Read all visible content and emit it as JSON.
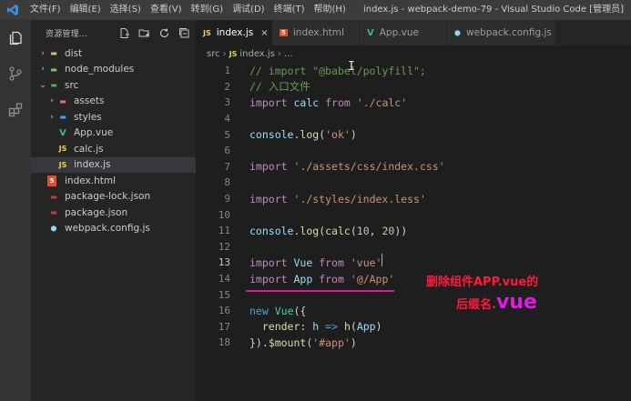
{
  "window": {
    "menu": [
      "文件(F)",
      "编辑(E)",
      "选择(S)",
      "查看(V)",
      "转到(G)",
      "调试(D)",
      "终端(T)",
      "帮助(H)"
    ],
    "title": "index.js - webpack-demo-79 - Visual Studio Code [管理员]"
  },
  "activity_bar": {
    "icons": [
      "files-icon",
      "source-control-icon",
      "extensions-icon"
    ]
  },
  "sidebar": {
    "title": "资源管理...",
    "actions": [
      "new-file-icon",
      "new-folder-icon",
      "refresh-icon",
      "collapse-all-icon"
    ],
    "tree": [
      {
        "label": "dist",
        "chevron": "›",
        "icon": "folder-icon"
      },
      {
        "label": "node_modules",
        "chevron": "›",
        "icon": "folder-node-icon"
      },
      {
        "label": "src",
        "chevron": "⌄",
        "icon": "folder-src-icon"
      },
      {
        "label": "assets",
        "chevron": "›",
        "icon": "folder-assets-icon"
      },
      {
        "label": "styles",
        "chevron": "›",
        "icon": "folder-styles-icon"
      },
      {
        "label": "App.vue",
        "chevron": "",
        "icon": "vue-file-icon",
        "badge": "V"
      },
      {
        "label": "calc.js",
        "chevron": "",
        "icon": "js-file-icon",
        "badge": "JS"
      },
      {
        "label": "index.js",
        "chevron": "",
        "icon": "js-file-icon",
        "badge": "JS"
      },
      {
        "label": "index.html",
        "chevron": "",
        "icon": "html-file-icon",
        "badge": "5"
      },
      {
        "label": "package-lock.json",
        "chevron": "",
        "icon": "npm-file-icon",
        "badge": ""
      },
      {
        "label": "package.json",
        "chevron": "",
        "icon": "npm-file-icon",
        "badge": ""
      },
      {
        "label": "webpack.config.js",
        "chevron": "",
        "icon": "webpack-file-icon",
        "badge": ""
      }
    ]
  },
  "tabs": [
    {
      "label": "index.js",
      "badge": "JS",
      "close": "×"
    },
    {
      "label": "index.html",
      "badge": "5",
      "close": ""
    },
    {
      "label": "App.vue",
      "badge": "V",
      "close": ""
    },
    {
      "label": "webpack.config.js",
      "badge": "",
      "close": ""
    }
  ],
  "breadcrumb": {
    "folder": "src",
    "sep": "›",
    "badge": "JS",
    "file": "index.js",
    "more": "..."
  },
  "editor": {
    "lines": [
      {
        "n": "1",
        "tokens": [
          [
            "cm",
            "// import \"@babel/polyfill\";"
          ]
        ]
      },
      {
        "n": "2",
        "tokens": [
          [
            "cm",
            "// 入口文件"
          ]
        ]
      },
      {
        "n": "3",
        "tokens": [
          [
            "kw",
            "import"
          ],
          [
            "pn",
            " "
          ],
          [
            "var",
            "calc"
          ],
          [
            "pn",
            " "
          ],
          [
            "kw",
            "from"
          ],
          [
            "pn",
            " "
          ],
          [
            "str",
            "'./calc'"
          ]
        ]
      },
      {
        "n": "4",
        "tokens": []
      },
      {
        "n": "5",
        "tokens": [
          [
            "var",
            "console"
          ],
          [
            "pn",
            "."
          ],
          [
            "fn",
            "log"
          ],
          [
            "pn",
            "("
          ],
          [
            "str",
            "'ok'"
          ],
          [
            "pn",
            ")"
          ]
        ]
      },
      {
        "n": "6",
        "tokens": []
      },
      {
        "n": "7",
        "tokens": [
          [
            "kw",
            "import"
          ],
          [
            "pn",
            " "
          ],
          [
            "str",
            "'./assets/css/index.css'"
          ]
        ]
      },
      {
        "n": "8",
        "tokens": []
      },
      {
        "n": "9",
        "tokens": [
          [
            "kw",
            "import"
          ],
          [
            "pn",
            " "
          ],
          [
            "str",
            "'./styles/index.less'"
          ]
        ]
      },
      {
        "n": "10",
        "tokens": []
      },
      {
        "n": "11",
        "tokens": [
          [
            "var",
            "console"
          ],
          [
            "pn",
            "."
          ],
          [
            "fn",
            "log"
          ],
          [
            "pn",
            "("
          ],
          [
            "fn",
            "calc"
          ],
          [
            "pn",
            "("
          ],
          [
            "num",
            "10"
          ],
          [
            "pn",
            ", "
          ],
          [
            "num",
            "20"
          ],
          [
            "pn",
            "))"
          ]
        ]
      },
      {
        "n": "12",
        "tokens": []
      },
      {
        "n": "13",
        "tokens": [
          [
            "kw",
            "import"
          ],
          [
            "pn",
            " "
          ],
          [
            "var",
            "Vue"
          ],
          [
            "pn",
            " "
          ],
          [
            "kw",
            "from"
          ],
          [
            "pn",
            " "
          ],
          [
            "str",
            "'vue'"
          ]
        ]
      },
      {
        "n": "14",
        "tokens": [
          [
            "kw",
            "import"
          ],
          [
            "pn",
            " "
          ],
          [
            "var",
            "App"
          ],
          [
            "pn",
            " "
          ],
          [
            "kw",
            "from"
          ],
          [
            "pn",
            " "
          ],
          [
            "str",
            "'@/App'"
          ]
        ]
      },
      {
        "n": "15",
        "tokens": []
      },
      {
        "n": "16",
        "tokens": [
          [
            "kwb",
            "new"
          ],
          [
            "pn",
            " "
          ],
          [
            "cls",
            "Vue"
          ],
          [
            "pn",
            "({"
          ]
        ]
      },
      {
        "n": "17",
        "tokens": [
          [
            "pn",
            "  "
          ],
          [
            "fn",
            "render"
          ],
          [
            "pn",
            ": "
          ],
          [
            "var",
            "h"
          ],
          [
            "pn",
            " "
          ],
          [
            "kwb",
            "=>"
          ],
          [
            "pn",
            " "
          ],
          [
            "fn",
            "h"
          ],
          [
            "pn",
            "("
          ],
          [
            "var",
            "App"
          ],
          [
            "pn",
            ")"
          ]
        ]
      },
      {
        "n": "18",
        "tokens": [
          [
            "pn",
            "})."
          ],
          [
            "fn",
            "$mount"
          ],
          [
            "pn",
            "("
          ],
          [
            "str",
            "'#app'"
          ],
          [
            "pn",
            ")"
          ]
        ]
      }
    ],
    "cursor_line": "13"
  },
  "annotation": {
    "line1": "删除组件APP.vue的",
    "line2_prefix": "后缀名.",
    "line2_big": "vue",
    "color": "#ff1a3c",
    "accent": "#e01ae6"
  },
  "colors": {
    "titlebar": "#3c3c3c",
    "activitybar": "#333333",
    "sidebar": "#252526",
    "editor": "#1e1e1e"
  }
}
